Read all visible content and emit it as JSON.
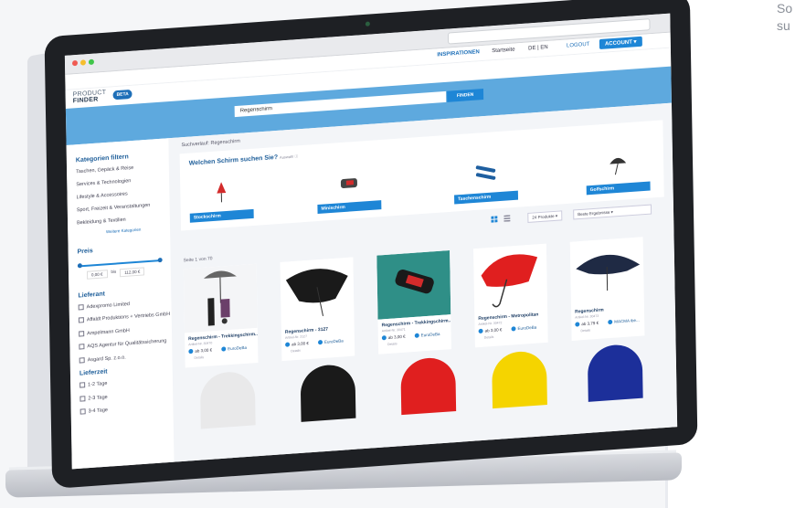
{
  "side_copy": [
    "So",
    "su"
  ],
  "browser": {
    "nav_glyphs": "‹ ›"
  },
  "topnav": {
    "inspiration": "INSPIRATIONEN",
    "start": "Startseite",
    "lang": "DE | EN",
    "login": "LOGOUT",
    "account": "ACCOUNT ▾"
  },
  "logo": {
    "line1": "PRODUCT",
    "line2": "FINDER",
    "badge": "BETA"
  },
  "search": {
    "value": "Regenschirm",
    "button": "FINDEN"
  },
  "sidebar": {
    "categories_title": "Kategorien filtern",
    "categories": [
      "Taschen, Gepäck & Reise",
      "Services & Technologien",
      "Lifestyle & Accessoires",
      "Sport, Freizeit & Veranstaltungen",
      "Bekleidung & Textilien"
    ],
    "more": "Weitere Kategorien",
    "price_title": "Preis",
    "price_min": "0,00 €",
    "price_sep": "bis",
    "price_max": "112,00 €",
    "supplier_title": "Lieferant",
    "suppliers": [
      "Adexpromo Limited",
      "Affaldt Produktions + Vertriebs GmbH",
      "Ampelmann GmbH",
      "AQS Agentur für Qualitätssicherung",
      "Asgard Sp. z.o.o."
    ],
    "delivery_title": "Lieferzeit",
    "delivery": [
      "1-2 Tage",
      "2-3 Tage",
      "3-4 Tage"
    ]
  },
  "main": {
    "breadcrumb": "Suchverlauf: Regenschirm",
    "finder_title": "Welchen Schirm suchen Sie?",
    "finder_hint": "Auswahl ⓘ",
    "categories": [
      "Stockschirm",
      "Minischirm",
      "Taschenschirm",
      "Golfschirm"
    ],
    "per_page": "24 Produkte ▾",
    "sort": "Beste Ergebnisse ▾",
    "page_info": "Seite 1 von 70"
  },
  "products": [
    {
      "name": "Regenschirm - Trekkingschirm...",
      "sub": "Artikel-Nr. 30470",
      "price": "ab 3,00 €",
      "supplier": "EuroDeBa",
      "tail": "Details"
    },
    {
      "name": "Regenschirm - 3127",
      "sub": "Artikel-Nr. 3127",
      "price": "ab 3,00 €",
      "supplier": "EuroDeBa",
      "tail": "Details"
    },
    {
      "name": "Regenschirm - Trekkingschirm...",
      "sub": "Artikel-Nr. 30471",
      "price": "ab 3,00 €",
      "supplier": "EuroDeBa",
      "tail": "Details"
    },
    {
      "name": "Regenschirm - Metropolitan",
      "sub": "Artikel-Nr. 30472",
      "price": "ab 3,00 €",
      "supplier": "EuroDeBa",
      "tail": "Details"
    },
    {
      "name": "Regenschirm",
      "sub": "Artikel-Nr. 30473",
      "price": "ab 3,79 €",
      "supplier": "MACMA ibe...",
      "tail": "Details"
    }
  ],
  "colors": {
    "brand": "#1e86d6",
    "banner": "#5ea9de",
    "title": "#1f5f9a"
  }
}
